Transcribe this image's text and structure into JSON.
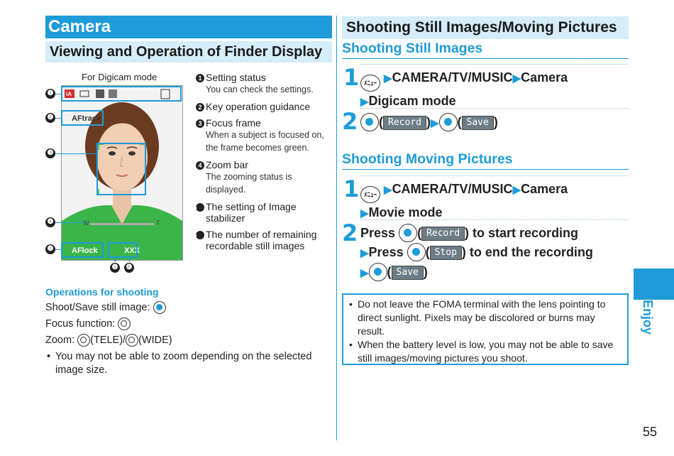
{
  "left": {
    "section_title": "Camera",
    "subsection_title": "Viewing and Operation of Finder Display",
    "figure_caption": "For Digicam mode",
    "callouts": [
      "❶",
      "❷",
      "❸",
      "❹",
      "❷",
      "❺",
      "❻"
    ],
    "screen": {
      "af_top": "AFtrack",
      "zoom_label_w": "W",
      "zoom_label_t": "T",
      "af_bottom": "AFlock",
      "remaining": "XXX"
    },
    "legend": [
      {
        "num": "1",
        "title": "Setting status",
        "desc": "You can check the settings."
      },
      {
        "num": "2",
        "title": "Key operation guidance",
        "desc": ""
      },
      {
        "num": "3",
        "title": "Focus frame",
        "desc": "When a subject is focused on, the frame becomes green."
      },
      {
        "num": "4",
        "title": "Zoom bar",
        "desc": "The zooming status is displayed."
      },
      {
        "num": "5",
        "title": "The setting of Image stabilizer",
        "desc": ""
      },
      {
        "num": "6",
        "title": "The number of remaining recordable still images",
        "desc": ""
      }
    ],
    "ops_title": "Operations for shooting",
    "ops": {
      "shoot": "Shoot/Save still image:",
      "focus": "Focus function:",
      "zoom_prefix": "Zoom:",
      "zoom_tele": "(TELE)/",
      "zoom_wide": "(WIDE)"
    },
    "ops_note": "You may not be able to zoom depending on the selected image size."
  },
  "right": {
    "section_title": "Shooting Still Images/Moving Pictures",
    "still_title": "Shooting Still Images",
    "still_steps": [
      {
        "num": "1",
        "line1": "CAMERA/TV/MUSIC",
        "line1b": "Camera",
        "line2": "Digicam mode"
      },
      {
        "num": "2",
        "record": "Record",
        "save": "Save"
      }
    ],
    "movie_title": "Shooting Moving Pictures",
    "movie_steps": [
      {
        "num": "1",
        "line1": "CAMERA/TV/MUSIC",
        "line1b": "Camera",
        "line2": "Movie mode"
      },
      {
        "num": "2",
        "press1": "Press",
        "record": "Record",
        "start": "to start recording",
        "press2": "Press",
        "stop": "Stop",
        "end": "to end the recording",
        "save": "Save"
      }
    ],
    "menu_key_label": "ﾒﾆｭｰ",
    "notes": [
      "Do not leave the FOMA terminal with the lens pointing to direct sunlight. Pixels may be discolored or burns may result.",
      "When the battery level is low, you may not be able to save still images/moving pictures you shoot."
    ]
  },
  "side_tab": "Enjoy",
  "page_number": "55",
  "colors": {
    "accent": "#1e9bd8",
    "header_light": "#d4edf9"
  }
}
